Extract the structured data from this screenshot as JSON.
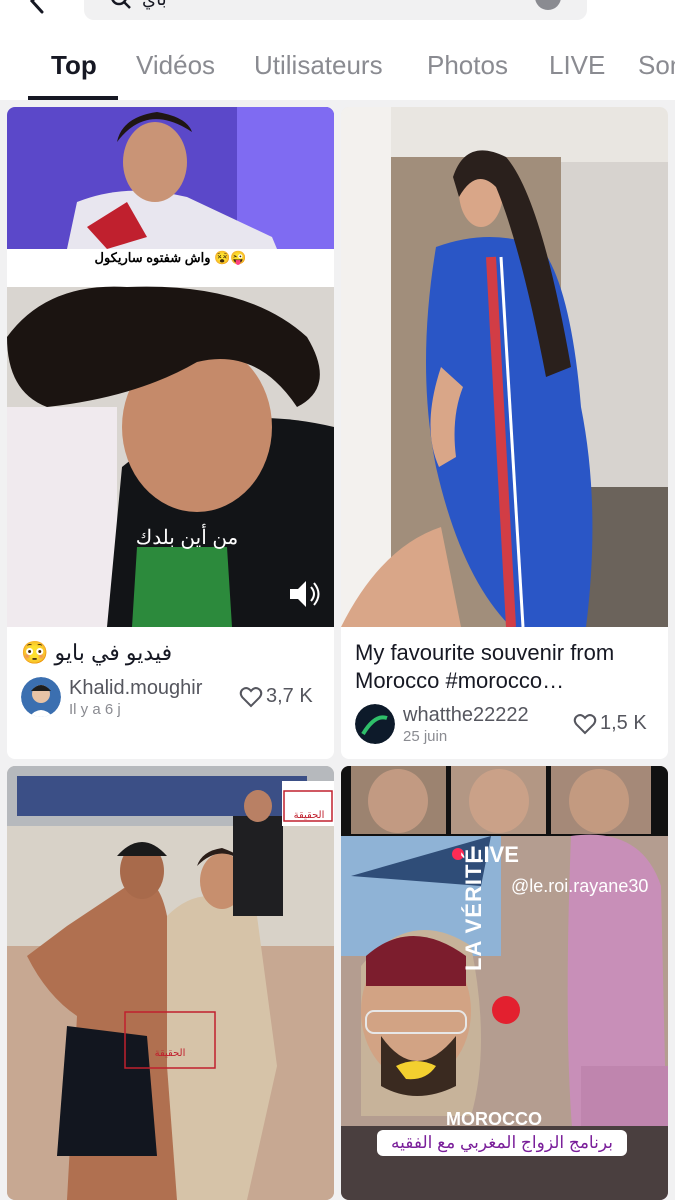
{
  "search": {
    "query": "باي"
  },
  "tabs": [
    "Top",
    "Vidéos",
    "Utilisateurs",
    "Photos",
    "LIVE",
    "Sons"
  ],
  "cards": [
    {
      "overlay_top": "واش شفتوه ساريكول 😵😜",
      "overlay_mid": "من أين بلدك",
      "caption": "😳 فيديو في بايو",
      "username": "Khalid.moughir",
      "date": "Il y a 6 j",
      "likes": "3,7 K"
    },
    {
      "caption": "My favourite souvenir from Morocco #morocco…",
      "username": "whatthe22222",
      "date": "25 juin",
      "likes": "1,5 K"
    },
    {
      "watermark": "الحقيقة",
      "watermark2": "الحقيقة"
    },
    {
      "live_label": "LIVE",
      "handle": "@le.roi.rayane30",
      "verite": "LA VÉRITÉ",
      "morocco": "MOROCCO",
      "banner": "برنامج الزواج المغربي مع الفقيه"
    }
  ],
  "colors": {
    "accent": "#161823",
    "muted": "#8a8b91",
    "live_red": "#fe2c55"
  }
}
